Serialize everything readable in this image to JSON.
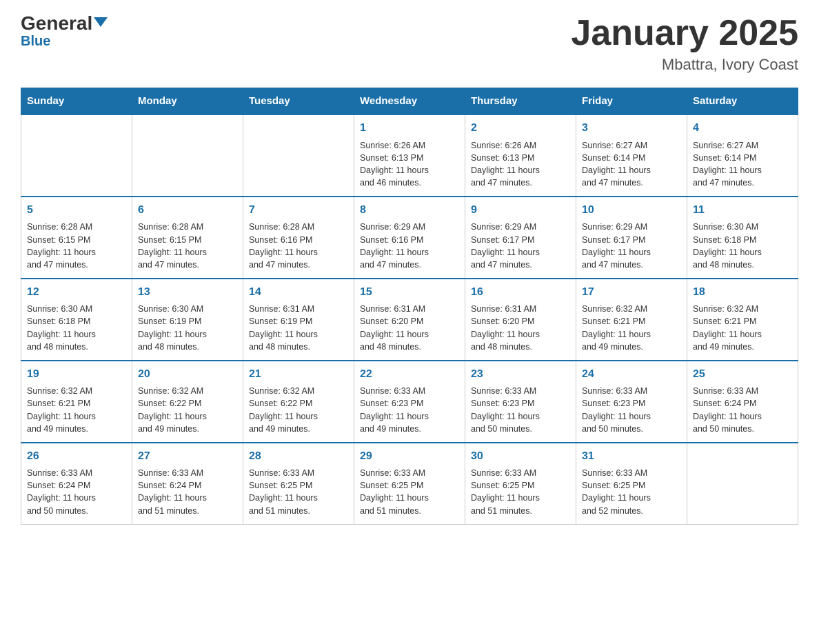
{
  "header": {
    "logo_general": "General",
    "logo_blue": "Blue",
    "month_title": "January 2025",
    "location": "Mbattra, Ivory Coast"
  },
  "weekdays": [
    "Sunday",
    "Monday",
    "Tuesday",
    "Wednesday",
    "Thursday",
    "Friday",
    "Saturday"
  ],
  "weeks": [
    [
      {
        "day": "",
        "info": ""
      },
      {
        "day": "",
        "info": ""
      },
      {
        "day": "",
        "info": ""
      },
      {
        "day": "1",
        "info": "Sunrise: 6:26 AM\nSunset: 6:13 PM\nDaylight: 11 hours\nand 46 minutes."
      },
      {
        "day": "2",
        "info": "Sunrise: 6:26 AM\nSunset: 6:13 PM\nDaylight: 11 hours\nand 47 minutes."
      },
      {
        "day": "3",
        "info": "Sunrise: 6:27 AM\nSunset: 6:14 PM\nDaylight: 11 hours\nand 47 minutes."
      },
      {
        "day": "4",
        "info": "Sunrise: 6:27 AM\nSunset: 6:14 PM\nDaylight: 11 hours\nand 47 minutes."
      }
    ],
    [
      {
        "day": "5",
        "info": "Sunrise: 6:28 AM\nSunset: 6:15 PM\nDaylight: 11 hours\nand 47 minutes."
      },
      {
        "day": "6",
        "info": "Sunrise: 6:28 AM\nSunset: 6:15 PM\nDaylight: 11 hours\nand 47 minutes."
      },
      {
        "day": "7",
        "info": "Sunrise: 6:28 AM\nSunset: 6:16 PM\nDaylight: 11 hours\nand 47 minutes."
      },
      {
        "day": "8",
        "info": "Sunrise: 6:29 AM\nSunset: 6:16 PM\nDaylight: 11 hours\nand 47 minutes."
      },
      {
        "day": "9",
        "info": "Sunrise: 6:29 AM\nSunset: 6:17 PM\nDaylight: 11 hours\nand 47 minutes."
      },
      {
        "day": "10",
        "info": "Sunrise: 6:29 AM\nSunset: 6:17 PM\nDaylight: 11 hours\nand 47 minutes."
      },
      {
        "day": "11",
        "info": "Sunrise: 6:30 AM\nSunset: 6:18 PM\nDaylight: 11 hours\nand 48 minutes."
      }
    ],
    [
      {
        "day": "12",
        "info": "Sunrise: 6:30 AM\nSunset: 6:18 PM\nDaylight: 11 hours\nand 48 minutes."
      },
      {
        "day": "13",
        "info": "Sunrise: 6:30 AM\nSunset: 6:19 PM\nDaylight: 11 hours\nand 48 minutes."
      },
      {
        "day": "14",
        "info": "Sunrise: 6:31 AM\nSunset: 6:19 PM\nDaylight: 11 hours\nand 48 minutes."
      },
      {
        "day": "15",
        "info": "Sunrise: 6:31 AM\nSunset: 6:20 PM\nDaylight: 11 hours\nand 48 minutes."
      },
      {
        "day": "16",
        "info": "Sunrise: 6:31 AM\nSunset: 6:20 PM\nDaylight: 11 hours\nand 48 minutes."
      },
      {
        "day": "17",
        "info": "Sunrise: 6:32 AM\nSunset: 6:21 PM\nDaylight: 11 hours\nand 49 minutes."
      },
      {
        "day": "18",
        "info": "Sunrise: 6:32 AM\nSunset: 6:21 PM\nDaylight: 11 hours\nand 49 minutes."
      }
    ],
    [
      {
        "day": "19",
        "info": "Sunrise: 6:32 AM\nSunset: 6:21 PM\nDaylight: 11 hours\nand 49 minutes."
      },
      {
        "day": "20",
        "info": "Sunrise: 6:32 AM\nSunset: 6:22 PM\nDaylight: 11 hours\nand 49 minutes."
      },
      {
        "day": "21",
        "info": "Sunrise: 6:32 AM\nSunset: 6:22 PM\nDaylight: 11 hours\nand 49 minutes."
      },
      {
        "day": "22",
        "info": "Sunrise: 6:33 AM\nSunset: 6:23 PM\nDaylight: 11 hours\nand 49 minutes."
      },
      {
        "day": "23",
        "info": "Sunrise: 6:33 AM\nSunset: 6:23 PM\nDaylight: 11 hours\nand 50 minutes."
      },
      {
        "day": "24",
        "info": "Sunrise: 6:33 AM\nSunset: 6:23 PM\nDaylight: 11 hours\nand 50 minutes."
      },
      {
        "day": "25",
        "info": "Sunrise: 6:33 AM\nSunset: 6:24 PM\nDaylight: 11 hours\nand 50 minutes."
      }
    ],
    [
      {
        "day": "26",
        "info": "Sunrise: 6:33 AM\nSunset: 6:24 PM\nDaylight: 11 hours\nand 50 minutes."
      },
      {
        "day": "27",
        "info": "Sunrise: 6:33 AM\nSunset: 6:24 PM\nDaylight: 11 hours\nand 51 minutes."
      },
      {
        "day": "28",
        "info": "Sunrise: 6:33 AM\nSunset: 6:25 PM\nDaylight: 11 hours\nand 51 minutes."
      },
      {
        "day": "29",
        "info": "Sunrise: 6:33 AM\nSunset: 6:25 PM\nDaylight: 11 hours\nand 51 minutes."
      },
      {
        "day": "30",
        "info": "Sunrise: 6:33 AM\nSunset: 6:25 PM\nDaylight: 11 hours\nand 51 minutes."
      },
      {
        "day": "31",
        "info": "Sunrise: 6:33 AM\nSunset: 6:25 PM\nDaylight: 11 hours\nand 52 minutes."
      },
      {
        "day": "",
        "info": ""
      }
    ]
  ]
}
